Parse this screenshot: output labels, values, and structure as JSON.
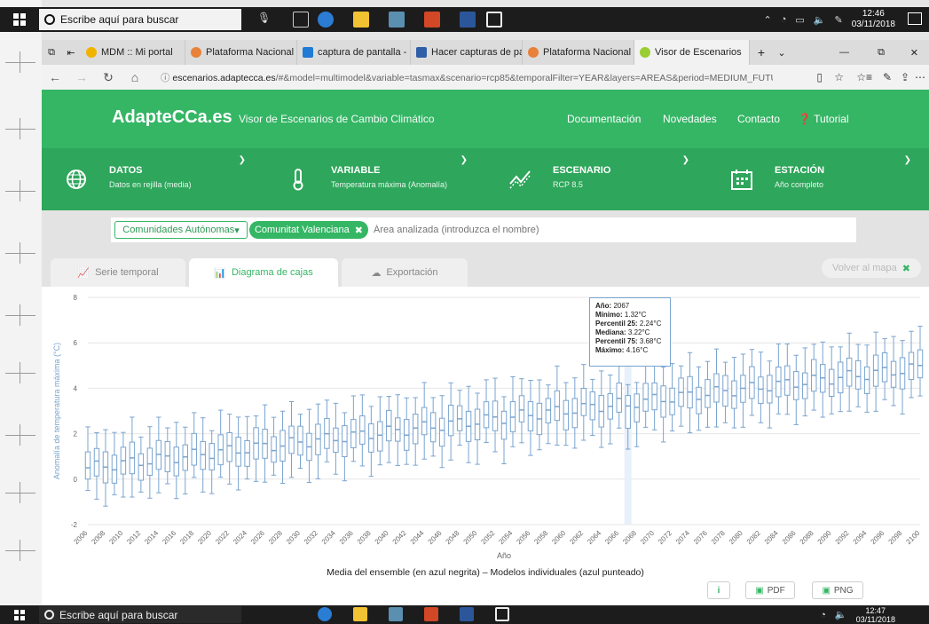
{
  "taskbar_top": {
    "search_placeholder": "Escribe aquí para buscar",
    "time": "12:46",
    "date": "03/11/2018"
  },
  "taskbar_bottom": {
    "search_placeholder": "Escribe aquí para buscar",
    "time": "12:47",
    "date": "03/11/2018"
  },
  "browser": {
    "tabs": [
      {
        "label": "MDM :: Mi portal",
        "color": "#f0b400"
      },
      {
        "label": "Plataforma Nacional de",
        "color": "#e8823a"
      },
      {
        "label": "captura de pantalla - Bi",
        "color": "#1f7bd4"
      },
      {
        "label": "Hacer capturas de pant",
        "color": "#2f5ea8"
      },
      {
        "label": "Plataforma Nacional de",
        "color": "#e8823a"
      },
      {
        "label": "Visor de Escenarios",
        "color": "#9acd32"
      }
    ],
    "url_domain": "escenarios.adaptecca.es",
    "url_rest": "/#&model=multimodel&variable=tasmax&scenario=rcp85&temporalFilter=YEAR&layers=AREAS&period=MEDIUM_FUTURE&ai"
  },
  "header": {
    "logo": "AdapteCCa.es",
    "subtitle": "Visor de Escenarios de Cambio Climático",
    "nav": [
      "Documentación",
      "Novedades",
      "Contacto",
      "Tutorial"
    ]
  },
  "selectors": [
    {
      "title": "DATOS",
      "value": "Datos en rejilla (media)",
      "icon": "globe-icon"
    },
    {
      "title": "VARIABLE",
      "value": "Temperatura máxima (Anomalía)",
      "icon": "thermometer-icon"
    },
    {
      "title": "ESCENARIO",
      "value": "RCP 8.5",
      "icon": "trend-icon"
    },
    {
      "title": "ESTACIÓN",
      "value": "Año completo",
      "icon": "calendar-icon"
    }
  ],
  "filter": {
    "region_type": "Comunidades Autónomas",
    "region": "Comunitat Valenciana",
    "placeholder": "Área analizada (introduzca el nombre)"
  },
  "content_tabs": [
    "Serie temporal",
    "Diagrama de cajas",
    "Exportación"
  ],
  "map_button": "Volver al mapa",
  "tooltip": {
    "year_label": "Año:",
    "year": "2067",
    "min_label": "Mínimo:",
    "min": "1.32°C",
    "p25_label": "Percentil 25:",
    "p25": "2.24°C",
    "median_label": "Mediana:",
    "median": "3.22°C",
    "p75_label": "Percentil 75:",
    "p75": "3.68°C",
    "max_label": "Máximo:",
    "max": "4.16°C"
  },
  "export": {
    "info": "i",
    "pdf": "PDF",
    "png": "PNG"
  },
  "colors": {
    "green": "#35b665",
    "box_blue": "#7aa4cf"
  },
  "chart_data": {
    "type": "box",
    "title": "",
    "xlabel": "Año",
    "ylabel": "Anomalía de temperatura máxima (°C)",
    "caption": "Media del ensemble (en azul negrita) – Modelos individuales (azul punteado)",
    "ylim": [
      -2,
      8
    ],
    "yticks": [
      -2,
      0,
      2,
      4,
      6,
      8
    ],
    "xtick_labels": [
      "2006",
      "2008",
      "2010",
      "2012",
      "2014",
      "2016",
      "2018",
      "2020",
      "2022",
      "2024",
      "2026",
      "2028",
      "2030",
      "2032",
      "2034",
      "2036",
      "2038",
      "2040",
      "2042",
      "2044",
      "2046",
      "2048",
      "2050",
      "2052",
      "2054",
      "2056",
      "2058",
      "2060",
      "2062",
      "2064",
      "2066",
      "2068",
      "2070",
      "2072",
      "2074",
      "2076",
      "2078",
      "2080",
      "2082",
      "2084",
      "2086",
      "2088",
      "2090",
      "2092",
      "2094",
      "2096",
      "2098",
      "2100"
    ],
    "highlight_year": 2067,
    "highlight_box": {
      "min": 1.32,
      "q1": 2.24,
      "median": 3.22,
      "q3": 3.68,
      "max": 4.16
    },
    "median_start": 0.5,
    "median_end": 4.9,
    "years_start": 2006,
    "years_end": 2100
  }
}
